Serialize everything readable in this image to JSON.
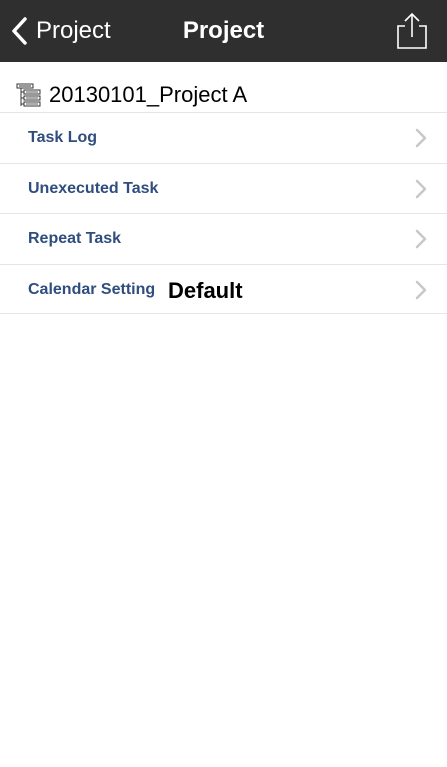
{
  "navbar": {
    "back_label": "Project",
    "title": "Project",
    "back_icon": "chevron-left-icon",
    "share_icon": "share-icon"
  },
  "project": {
    "name": "20130101_Project A",
    "icon": "project-tree-icon"
  },
  "menu": {
    "items": [
      {
        "label": "Task Log",
        "value": ""
      },
      {
        "label": "Unexecuted Task",
        "value": ""
      },
      {
        "label": "Repeat Task",
        "value": ""
      },
      {
        "label": "Calendar Setting",
        "value": "Default"
      }
    ]
  },
  "colors": {
    "navbar_bg": "#2f2f2f",
    "menu_label": "#2f4d7e",
    "chevron": "#c7c7cc"
  }
}
